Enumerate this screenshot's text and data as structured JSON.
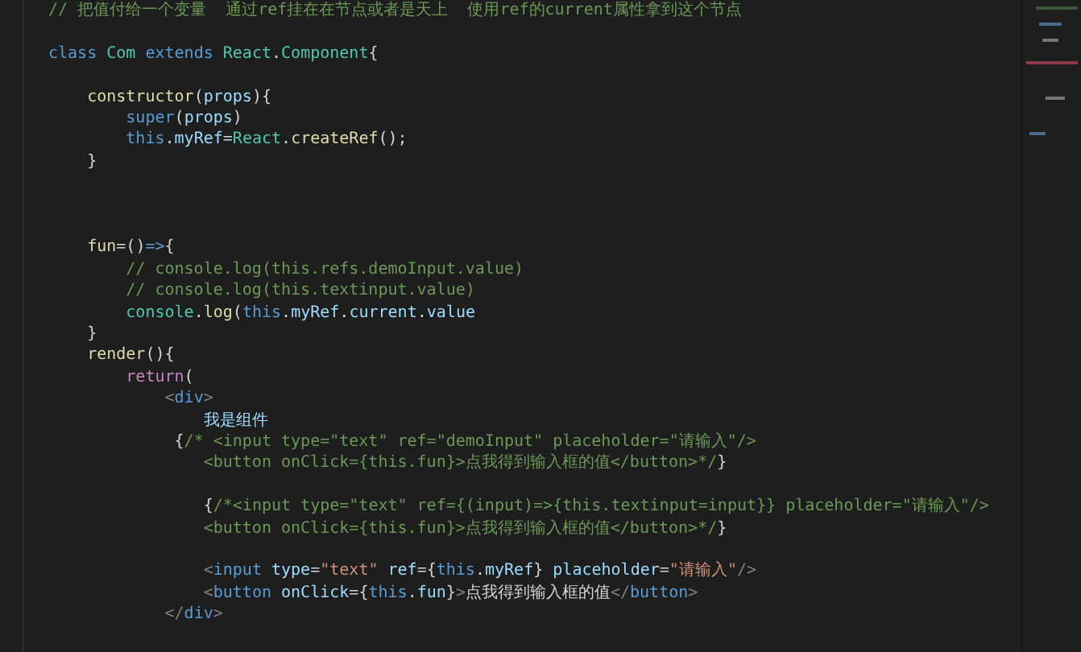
{
  "editor": {
    "lines": [
      {
        "kind": "code",
        "tokens": [
          {
            "t": "// 把值付给一个变量  通过ref挂在在节点或者是天上  使用ref的current属性拿到这个节点",
            "kind": "comment"
          }
        ]
      },
      {
        "kind": "blank"
      },
      {
        "kind": "code",
        "tokens": [
          {
            "t": "class ",
            "kind": "kw"
          },
          {
            "t": "Com ",
            "kind": "type"
          },
          {
            "t": "extends ",
            "kind": "kw"
          },
          {
            "t": "React",
            "kind": "type"
          },
          {
            "t": ".",
            "kind": "plain"
          },
          {
            "t": "Component",
            "kind": "type"
          },
          {
            "t": "{",
            "kind": "plain"
          }
        ]
      },
      {
        "kind": "blank"
      },
      {
        "kind": "code",
        "tokens": [
          {
            "t": "    constructor",
            "kind": "func"
          },
          {
            "t": "(",
            "kind": "plain"
          },
          {
            "t": "props",
            "kind": "var"
          },
          {
            "t": "){",
            "kind": "plain"
          }
        ]
      },
      {
        "kind": "code",
        "tokens": [
          {
            "t": "        super",
            "kind": "kw"
          },
          {
            "t": "(",
            "kind": "plain"
          },
          {
            "t": "props",
            "kind": "var"
          },
          {
            "t": ")",
            "kind": "plain"
          }
        ]
      },
      {
        "kind": "code",
        "tokens": [
          {
            "t": "        this",
            "kind": "kw"
          },
          {
            "t": ".",
            "kind": "plain"
          },
          {
            "t": "myRef",
            "kind": "var"
          },
          {
            "t": "=",
            "kind": "plain"
          },
          {
            "t": "React",
            "kind": "type"
          },
          {
            "t": ".",
            "kind": "plain"
          },
          {
            "t": "createRef",
            "kind": "func"
          },
          {
            "t": "();",
            "kind": "plain"
          }
        ]
      },
      {
        "kind": "code",
        "tokens": [
          {
            "t": "    }",
            "kind": "plain"
          }
        ]
      },
      {
        "kind": "blank"
      },
      {
        "kind": "blank"
      },
      {
        "kind": "blank"
      },
      {
        "kind": "code",
        "tokens": [
          {
            "t": "    fun",
            "kind": "func"
          },
          {
            "t": "=()",
            "kind": "plain"
          },
          {
            "t": "=>",
            "kind": "kw"
          },
          {
            "t": "{",
            "kind": "plain"
          }
        ]
      },
      {
        "kind": "code",
        "tokens": [
          {
            "t": "        // console.log(this.refs.demoInput.value)",
            "kind": "comment"
          }
        ]
      },
      {
        "kind": "code",
        "tokens": [
          {
            "t": "        // console.log(this.textinput.value)",
            "kind": "comment"
          }
        ]
      },
      {
        "kind": "code",
        "tokens": [
          {
            "t": "        console",
            "kind": "type"
          },
          {
            "t": ".",
            "kind": "plain"
          },
          {
            "t": "log",
            "kind": "func"
          },
          {
            "t": "(",
            "kind": "plain"
          },
          {
            "t": "this",
            "kind": "kw"
          },
          {
            "t": ".",
            "kind": "plain"
          },
          {
            "t": "myRef",
            "kind": "var"
          },
          {
            "t": ".",
            "kind": "plain"
          },
          {
            "t": "current",
            "kind": "var"
          },
          {
            "t": ".",
            "kind": "plain"
          },
          {
            "t": "value",
            "kind": "var"
          }
        ]
      },
      {
        "kind": "code",
        "tokens": [
          {
            "t": "    }",
            "kind": "plain"
          }
        ]
      },
      {
        "kind": "code",
        "tokens": [
          {
            "t": "    render",
            "kind": "func"
          },
          {
            "t": "(){",
            "kind": "plain"
          }
        ]
      },
      {
        "kind": "code",
        "tokens": [
          {
            "t": "        return",
            "kind": "kw2"
          },
          {
            "t": "(",
            "kind": "plain"
          }
        ]
      },
      {
        "kind": "code",
        "tokens": [
          {
            "t": "            <",
            "kind": "tag"
          },
          {
            "t": "div",
            "kind": "tagname"
          },
          {
            "t": ">",
            "kind": "tag"
          }
        ]
      },
      {
        "kind": "code",
        "tokens": [
          {
            "t": "                我是组件",
            "kind": "var"
          }
        ]
      },
      {
        "kind": "code",
        "tokens": [
          {
            "t": "             {",
            "kind": "plain"
          },
          {
            "t": "/* <input type=\"text\" ref=\"demoInput\" placeholder=\"请输入\"/>",
            "kind": "comment"
          }
        ]
      },
      {
        "kind": "code",
        "tokens": [
          {
            "t": "                <button onClick={this.fun}>点我得到输入框的值</button>*/",
            "kind": "comment"
          },
          {
            "t": "}",
            "kind": "plain"
          }
        ]
      },
      {
        "kind": "blank"
      },
      {
        "kind": "code",
        "tokens": [
          {
            "t": "                {",
            "kind": "plain"
          },
          {
            "t": "/*<input type=\"text\" ref={(input)=>{this.textinput=input}} placeholder=\"请输入\"/>",
            "kind": "comment"
          }
        ]
      },
      {
        "kind": "code",
        "tokens": [
          {
            "t": "                <button onClick={this.fun}>点我得到输入框的值</button>*/",
            "kind": "comment"
          },
          {
            "t": "}",
            "kind": "plain"
          }
        ]
      },
      {
        "kind": "blank"
      },
      {
        "kind": "code",
        "tokens": [
          {
            "t": "                <",
            "kind": "tag"
          },
          {
            "t": "input ",
            "kind": "tagname"
          },
          {
            "t": "type",
            "kind": "var"
          },
          {
            "t": "=",
            "kind": "plain"
          },
          {
            "t": "\"text\" ",
            "kind": "string"
          },
          {
            "t": "ref",
            "kind": "var"
          },
          {
            "t": "={",
            "kind": "plain"
          },
          {
            "t": "this",
            "kind": "kw"
          },
          {
            "t": ".",
            "kind": "plain"
          },
          {
            "t": "myRef",
            "kind": "var"
          },
          {
            "t": "} ",
            "kind": "plain"
          },
          {
            "t": "placeholder",
            "kind": "var"
          },
          {
            "t": "=",
            "kind": "plain"
          },
          {
            "t": "\"请输入\"",
            "kind": "string"
          },
          {
            "t": "/>",
            "kind": "tag"
          }
        ]
      },
      {
        "kind": "code",
        "tokens": [
          {
            "t": "                <",
            "kind": "tag"
          },
          {
            "t": "button ",
            "kind": "tagname"
          },
          {
            "t": "onClick",
            "kind": "var"
          },
          {
            "t": "={",
            "kind": "plain"
          },
          {
            "t": "this",
            "kind": "kw"
          },
          {
            "t": ".",
            "kind": "plain"
          },
          {
            "t": "fun",
            "kind": "var"
          },
          {
            "t": "}",
            "kind": "plain"
          },
          {
            "t": ">",
            "kind": "tag"
          },
          {
            "t": "点我得到输入框的值",
            "kind": "plain"
          },
          {
            "t": "</",
            "kind": "tag"
          },
          {
            "t": "button",
            "kind": "tagname"
          },
          {
            "t": ">",
            "kind": "tag"
          }
        ]
      },
      {
        "kind": "code",
        "tokens": [
          {
            "t": "            </",
            "kind": "tag"
          },
          {
            "t": "div",
            "kind": "tagname"
          },
          {
            "t": ">",
            "kind": "tag"
          }
        ]
      }
    ]
  }
}
